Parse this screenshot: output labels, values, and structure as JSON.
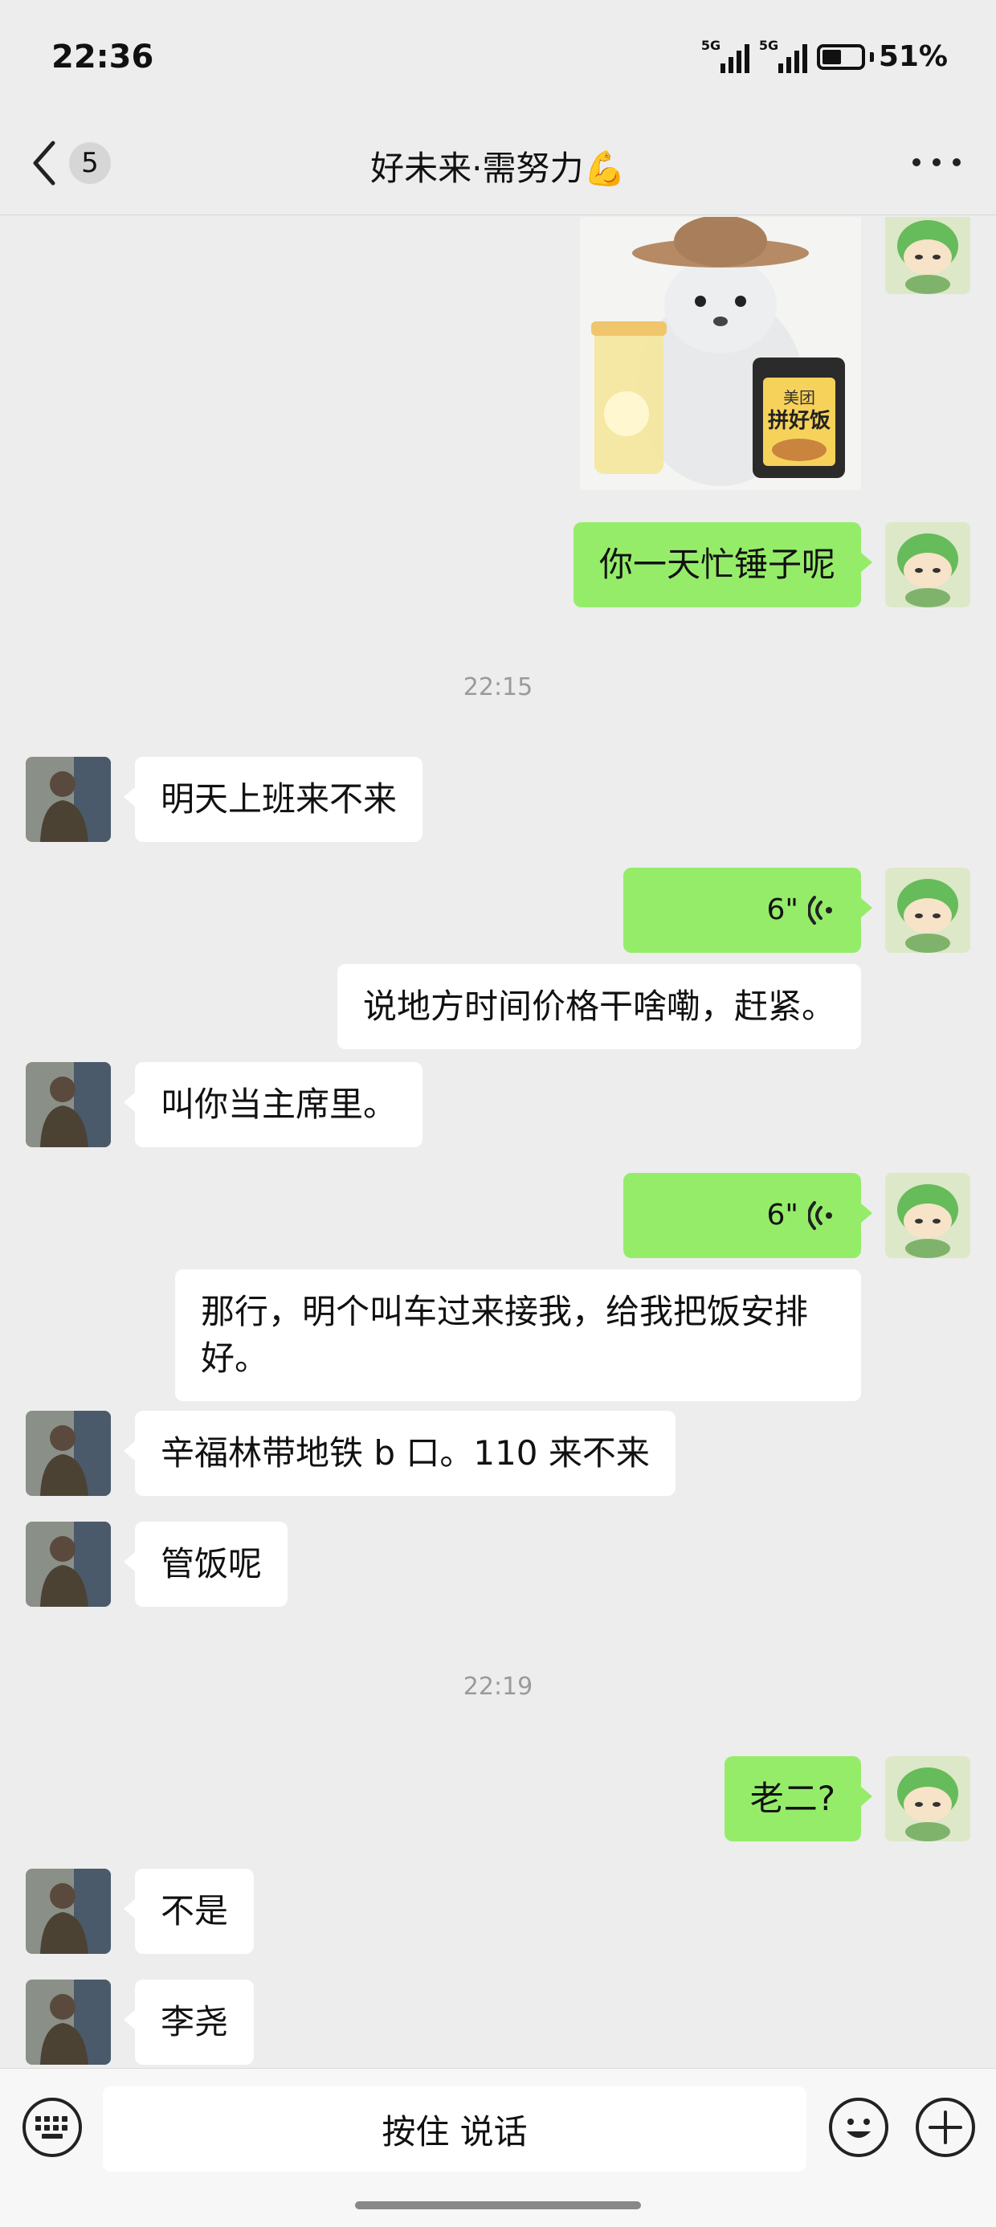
{
  "status_bar": {
    "time": "22:36",
    "signal_tag_1": "5G",
    "signal_tag_2": "5G",
    "battery_percent": "51%",
    "battery_level": 0.51
  },
  "header": {
    "unread_count": "5",
    "title": "好未来·需努力💪"
  },
  "messages": [
    {
      "type": "sticker",
      "from": "me",
      "sticker_text_1": "美团",
      "sticker_text_2": "拼好饭"
    },
    {
      "type": "text",
      "from": "me",
      "text": "你一天忙锤子呢"
    },
    {
      "type": "timestamp",
      "text": "22:15"
    },
    {
      "type": "text",
      "from": "other",
      "text": "明天上班来不来"
    },
    {
      "type": "voice",
      "from": "me",
      "duration": "6\""
    },
    {
      "type": "transcript",
      "from": "me",
      "text": "说地方时间价格干啥嘞，赶紧。"
    },
    {
      "type": "text",
      "from": "other",
      "text": "叫你当主席里。"
    },
    {
      "type": "voice",
      "from": "me",
      "duration": "6\""
    },
    {
      "type": "transcript",
      "from": "me",
      "text": "那行，明个叫车过来接我，给我把饭安排好。"
    },
    {
      "type": "text",
      "from": "other",
      "text": "辛福林带地铁 b 口。110 来不来"
    },
    {
      "type": "text",
      "from": "other",
      "text": "管饭呢"
    },
    {
      "type": "timestamp",
      "text": "22:19"
    },
    {
      "type": "text",
      "from": "me",
      "text": "老二?"
    },
    {
      "type": "text",
      "from": "other",
      "text": "不是"
    },
    {
      "type": "text",
      "from": "other",
      "text": "李尧"
    }
  ],
  "input_bar": {
    "hold_to_talk": "按住 说话"
  },
  "colors": {
    "background": "#ededed",
    "outgoing_bubble": "#95ec69",
    "incoming_bubble": "#ffffff"
  },
  "icons": {
    "back": "chevron-left-icon",
    "more": "more-dots-icon",
    "voice": "voice-wave-icon",
    "keyboard": "keyboard-icon",
    "emoji": "emoji-icon",
    "plus": "plus-icon"
  }
}
